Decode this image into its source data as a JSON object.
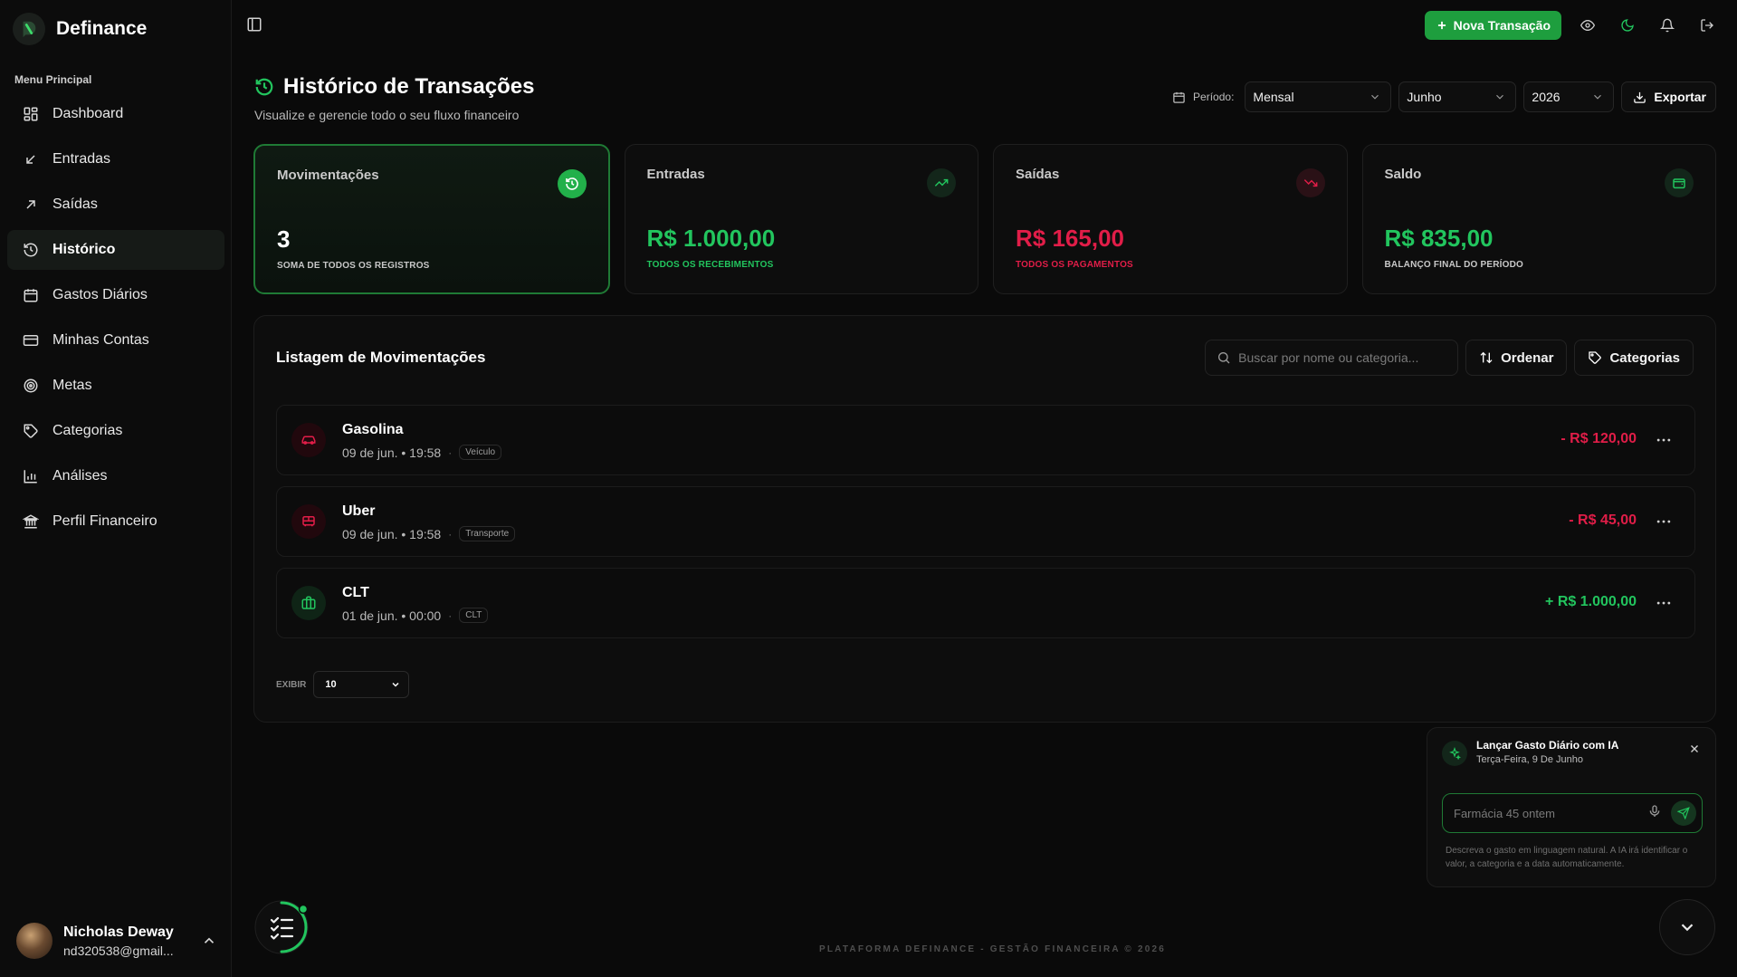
{
  "app": {
    "name": "Definance",
    "menu_label": "Menu Principal"
  },
  "sidebar": {
    "items": [
      {
        "label": "Dashboard",
        "icon": "dashboard-icon",
        "active": false
      },
      {
        "label": "Entradas",
        "icon": "arrow-down-left-icon",
        "active": false
      },
      {
        "label": "Saídas",
        "icon": "arrow-up-right-icon",
        "active": false
      },
      {
        "label": "Histórico",
        "icon": "history-icon",
        "active": true
      },
      {
        "label": "Gastos Diários",
        "icon": "calendar-icon",
        "active": false
      },
      {
        "label": "Minhas Contas",
        "icon": "credit-card-icon",
        "active": false
      },
      {
        "label": "Metas",
        "icon": "target-icon",
        "active": false
      },
      {
        "label": "Categorias",
        "icon": "tag-icon",
        "active": false
      },
      {
        "label": "Análises",
        "icon": "bar-chart-icon",
        "active": false
      },
      {
        "label": "Perfil Financeiro",
        "icon": "bank-icon",
        "active": false
      }
    ],
    "user": {
      "name": "Nicholas Deway",
      "email": "nd320538@gmail..."
    }
  },
  "topbar": {
    "new_transaction_label": "Nova Transação"
  },
  "header": {
    "title": "Histórico de Transações",
    "subtitle": "Visualize e gerencie todo o seu fluxo financeiro",
    "period_label": "Período:",
    "period_type": "Mensal",
    "month": "Junho",
    "year": "2026",
    "export_label": "Exportar"
  },
  "cards": [
    {
      "title": "Movimentações",
      "value": "3",
      "subtitle": "SOMA DE TODOS OS REGISTROS",
      "color": "#ffffff",
      "sub_color": "#c8c8c8",
      "icon": "history-icon"
    },
    {
      "title": "Entradas",
      "value": "R$ 1.000,00",
      "subtitle": "TODOS OS RECEBIMENTOS",
      "color": "#22c55e",
      "sub_color": "#22c55e",
      "icon": "trending-up-icon"
    },
    {
      "title": "Saídas",
      "value": "R$ 165,00",
      "subtitle": "TODOS OS PAGAMENTOS",
      "color": "#e11d48",
      "sub_color": "#e11d48",
      "icon": "trending-down-icon"
    },
    {
      "title": "Saldo",
      "value": "R$ 835,00",
      "subtitle": "BALANÇO FINAL DO PERÍODO",
      "color": "#22c55e",
      "sub_color": "#c8c8c8",
      "icon": "wallet-icon"
    }
  ],
  "list": {
    "title": "Listagem de Movimentações",
    "search_placeholder": "Buscar por nome ou categoria...",
    "sort_label": "Ordenar",
    "categories_label": "Categorias",
    "rows": [
      {
        "name": "Gasolina",
        "date": "09 de jun. • 19:58",
        "tag": "Veículo",
        "amount": "- R$ 120,00",
        "type": "expense",
        "icon": "car-icon"
      },
      {
        "name": "Uber",
        "date": "09 de jun. • 19:58",
        "tag": "Transporte",
        "amount": "- R$ 45,00",
        "type": "expense",
        "icon": "bus-icon"
      },
      {
        "name": "CLT",
        "date": "01 de jun. • 00:00",
        "tag": "CLT",
        "amount": "+ R$ 1.000,00",
        "type": "income",
        "icon": "briefcase-icon"
      }
    ],
    "page_size_label": "EXIBIR",
    "page_size": "10"
  },
  "ai_widget": {
    "title": "Lançar Gasto Diário com IA",
    "date": "Terça-Feira, 9 De Junho",
    "input_placeholder": "Farmácia 45 ontem",
    "help": "Descreva o gasto em linguagem natural. A IA irá identificar o valor, a categoria e a data automaticamente."
  },
  "footer": {
    "text": "PLATAFORMA DEFINANCE - GESTÃO FINANCEIRA © 2026"
  },
  "colors": {
    "accent": "#1e9e3e",
    "income": "#22c55e",
    "expense": "#e11d48"
  }
}
